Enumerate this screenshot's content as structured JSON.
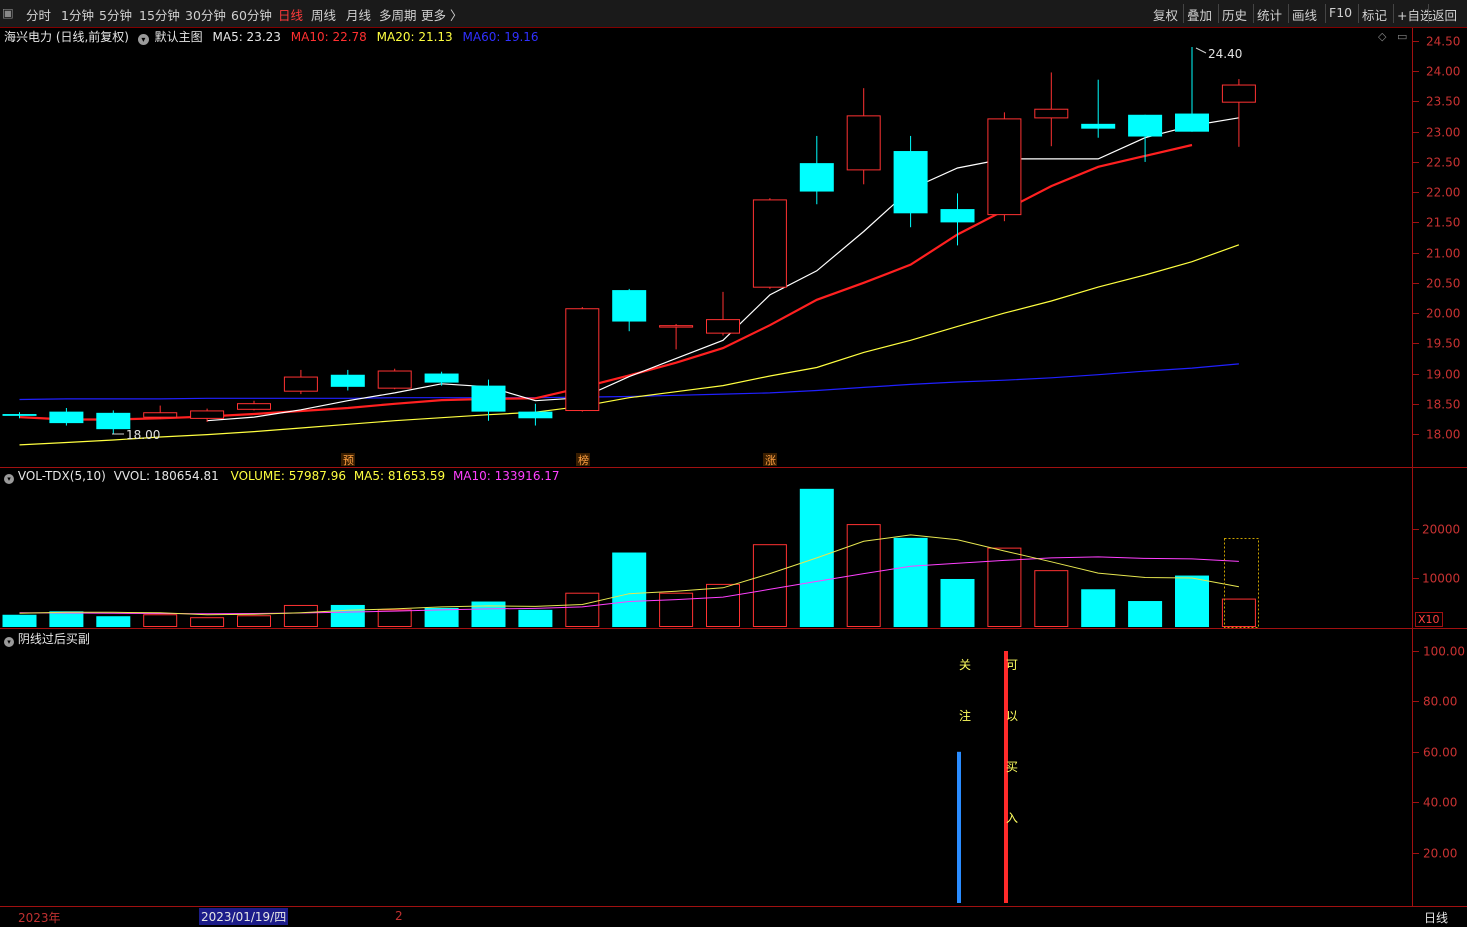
{
  "toolbar": {
    "left": [
      "分时",
      "1分钟",
      "5分钟",
      "15分钟",
      "30分钟",
      "60分钟",
      "日线",
      "周线",
      "月线",
      "多周期",
      "更多 〉"
    ],
    "active": "日线",
    "right": [
      "复权",
      "叠加",
      "历史",
      "统计",
      "画线",
      "F10",
      "标记",
      "+自选",
      "返回"
    ]
  },
  "main_panel": {
    "stock": "海兴电力 (日线,前复权)",
    "template": "默认主图",
    "ma5": "MA5: 23.23",
    "ma10": "MA10: 22.78",
    "ma20": "MA20: 21.13",
    "ma60": "MA60: 19.16",
    "high_label": "24.40",
    "low_label": "18.00",
    "y_ticks": [
      "24.50",
      "24.00",
      "23.50",
      "23.00",
      "22.50",
      "22.00",
      "21.50",
      "21.00",
      "20.50",
      "20.00",
      "19.50",
      "19.00",
      "18.50",
      "18.00"
    ],
    "markers": [
      "预",
      "榜",
      "涨"
    ]
  },
  "volume_panel": {
    "indicator": "VOL-TDX(5,10)",
    "vvol": "VVOL: 180654.81",
    "volume": "VOLUME: 57987.96",
    "ma5": "MA5: 81653.59",
    "ma10": "MA10: 133916.17",
    "y_ticks": [
      "20000",
      "10000"
    ],
    "unit": "X10"
  },
  "signal_panel": {
    "title": "阴线过后买副",
    "y_ticks": [
      "100.00",
      "80.00",
      "60.00",
      "40.00",
      "20.00"
    ],
    "watch_chars": [
      "关",
      "注"
    ],
    "buy_chars": [
      "可",
      "以",
      "买",
      "入"
    ]
  },
  "bottom_bar": {
    "year": "2023年",
    "date": "2023/01/19/四",
    "page": "2",
    "period": "日线"
  },
  "colors": {
    "up": "#ff3232",
    "down": "#00ffff",
    "ma5": "#ffffff",
    "ma10": "#ff2020",
    "ma20": "#ffff40",
    "ma60": "#2020ff",
    "vol_ma10": "#ff40ff"
  },
  "chart_data": [
    {
      "type": "candlestick",
      "title": "海兴电力 (日线,前复权)",
      "ylim": [
        17.7,
        24.65
      ],
      "candles": [
        {
          "o": 18.33,
          "h": 18.36,
          "l": 18.26,
          "c": 18.3
        },
        {
          "o": 18.37,
          "h": 18.43,
          "l": 18.14,
          "c": 18.18
        },
        {
          "o": 18.35,
          "h": 18.39,
          "l": 18.0,
          "c": 18.08
        },
        {
          "o": 18.27,
          "h": 18.47,
          "l": 18.25,
          "c": 18.36
        },
        {
          "o": 18.25,
          "h": 18.42,
          "l": 18.2,
          "c": 18.39
        },
        {
          "o": 18.4,
          "h": 18.55,
          "l": 18.39,
          "c": 18.51
        },
        {
          "o": 18.7,
          "h": 19.06,
          "l": 18.66,
          "c": 18.95
        },
        {
          "o": 18.98,
          "h": 19.06,
          "l": 18.72,
          "c": 18.78
        },
        {
          "o": 18.75,
          "h": 19.08,
          "l": 18.74,
          "c": 19.05
        },
        {
          "o": 19.0,
          "h": 19.03,
          "l": 18.8,
          "c": 18.85
        },
        {
          "o": 18.8,
          "h": 18.9,
          "l": 18.22,
          "c": 18.37
        },
        {
          "o": 18.37,
          "h": 18.5,
          "l": 18.14,
          "c": 18.26
        },
        {
          "o": 18.38,
          "h": 20.1,
          "l": 18.37,
          "c": 20.08
        },
        {
          "o": 20.38,
          "h": 20.4,
          "l": 19.7,
          "c": 19.86
        },
        {
          "o": 19.76,
          "h": 19.82,
          "l": 19.4,
          "c": 19.8
        },
        {
          "o": 19.66,
          "h": 20.35,
          "l": 19.63,
          "c": 19.9
        },
        {
          "o": 20.42,
          "h": 21.9,
          "l": 20.4,
          "c": 21.88
        },
        {
          "o": 22.48,
          "h": 22.93,
          "l": 21.8,
          "c": 22.01
        },
        {
          "o": 22.36,
          "h": 23.72,
          "l": 22.13,
          "c": 23.27
        },
        {
          "o": 22.68,
          "h": 22.93,
          "l": 21.42,
          "c": 21.65
        },
        {
          "o": 21.72,
          "h": 21.98,
          "l": 21.12,
          "c": 21.5
        },
        {
          "o": 21.62,
          "h": 23.32,
          "l": 21.52,
          "c": 23.22
        },
        {
          "o": 23.22,
          "h": 23.98,
          "l": 22.76,
          "c": 23.38
        },
        {
          "o": 23.13,
          "h": 23.86,
          "l": 22.9,
          "c": 23.05
        },
        {
          "o": 23.28,
          "h": 23.28,
          "l": 22.5,
          "c": 22.92
        },
        {
          "o": 23.3,
          "h": 24.4,
          "l": 23.0,
          "c": 23.0
        },
        {
          "o": 23.48,
          "h": 23.87,
          "l": 22.75,
          "c": 23.78
        }
      ],
      "ma5": [
        null,
        null,
        null,
        null,
        18.22,
        18.28,
        18.4,
        18.55,
        18.68,
        18.83,
        18.78,
        18.55,
        18.6,
        18.95,
        19.25,
        19.55,
        20.3,
        20.7,
        21.35,
        22.05,
        22.4,
        22.55,
        22.55,
        22.55,
        22.9,
        23.1,
        23.23
      ],
      "ma10": [
        18.28,
        18.24,
        18.24,
        18.26,
        18.29,
        18.33,
        18.38,
        18.43,
        18.5,
        18.56,
        18.58,
        18.59,
        18.77,
        18.97,
        19.18,
        19.42,
        19.8,
        20.22,
        20.5,
        20.8,
        21.3,
        21.7,
        22.1,
        22.42,
        22.6,
        22.78
      ],
      "ma20": [
        17.82,
        17.86,
        17.9,
        17.95,
        17.99,
        18.04,
        18.1,
        18.16,
        18.22,
        18.27,
        18.32,
        18.36,
        18.46,
        18.6,
        18.7,
        18.8,
        18.96,
        19.1,
        19.35,
        19.55,
        19.78,
        20.0,
        20.2,
        20.43,
        20.63,
        20.85,
        21.13
      ],
      "ma60": [
        18.57,
        18.58,
        18.58,
        18.58,
        18.59,
        18.59,
        18.59,
        18.59,
        18.6,
        18.6,
        18.6,
        18.6,
        18.61,
        18.62,
        18.64,
        18.66,
        18.68,
        18.72,
        18.77,
        18.82,
        18.86,
        18.89,
        18.93,
        18.98,
        19.04,
        19.09,
        19.16
      ]
    },
    {
      "type": "bar",
      "title": "VOL-TDX(5,10)",
      "ylim": [
        0,
        28500
      ],
      "values": [
        2500,
        3200,
        2200,
        2600,
        2000,
        2400,
        4500,
        4500,
        3600,
        3900,
        5200,
        3500,
        7000,
        15200,
        7000,
        8800,
        16900,
        28200,
        21000,
        18200,
        9800,
        16200,
        11600,
        7700,
        5300,
        10500,
        5800
      ],
      "ma5": [
        2800,
        3000,
        3000,
        2900,
        2500,
        2600,
        2900,
        3400,
        3700,
        4100,
        4300,
        4200,
        4600,
        6800,
        7300,
        8000,
        10900,
        14100,
        17500,
        18800,
        17800,
        15500,
        13300,
        11000,
        10100,
        10000,
        8200
      ],
      "ma10": [
        2900,
        2850,
        2800,
        2750,
        2700,
        2750,
        2850,
        3050,
        3250,
        3500,
        3700,
        3800,
        4100,
        5200,
        5600,
        6100,
        7700,
        9300,
        10900,
        12400,
        13000,
        13600,
        14100,
        14300,
        14000,
        13900,
        13392
      ]
    },
    {
      "type": "bar",
      "title": "阴线过后买副",
      "ylim": [
        0,
        105
      ],
      "signals": [
        {
          "name": "关注",
          "index": 20,
          "value": 60
        },
        {
          "name": "可以买入",
          "index": 21,
          "value": 100
        }
      ]
    }
  ]
}
